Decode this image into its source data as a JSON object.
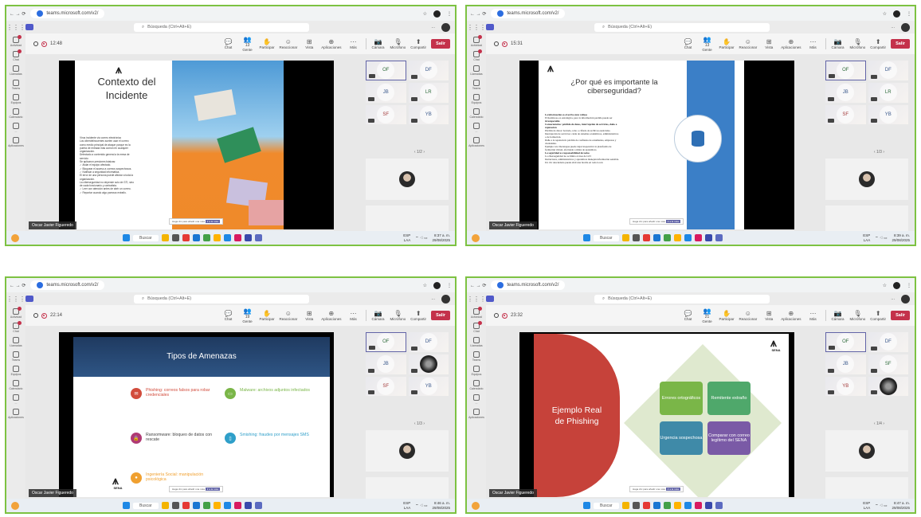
{
  "colors": {
    "frame": "#7dc242",
    "leave": "#c4314b",
    "teams": "#5059c9"
  },
  "browser": {
    "url": "teams.microsoft.com/v2/"
  },
  "app": {
    "search_placeholder": "Búsqueda (Ctrl+Alt+E)",
    "more": "..."
  },
  "rail": [
    "Actividad",
    "Chat",
    "Llamadas",
    "Teams",
    "Equipos",
    "Calendario",
    "...",
    "Aplicaciones"
  ],
  "toolbar": {
    "chat": "Chat",
    "people": "Gente",
    "raise": "Participar",
    "react": "Reaccionar",
    "view": "Vista",
    "apps": "Aplicaciones",
    "more": "Más",
    "camera": "Cámara",
    "mic": "Micrófono",
    "share": "Compartir",
    "leave": "Salir"
  },
  "taskbar": {
    "search": "Buscar",
    "lang": "ESP",
    "lang2": "LAA"
  },
  "slide_ui": {
    "chip_text": "Haga clic para añadir una nota",
    "chip_btn": "Ir a la nota"
  },
  "panels": [
    {
      "timer": "12:48",
      "people_count": "13",
      "tiles": [
        "OF",
        "DF",
        "JB",
        "LR",
        "SF",
        "YB"
      ],
      "pager": "1/2",
      "speaker": "Oscar Javier Figueredo",
      "clock_time": "8:37 a. m.",
      "clock_date": "29/08/2025",
      "slide": {
        "logo": "SENA",
        "title": "Contexto del Incidente",
        "body": [
          "Virus incidente vía correo electrónico",
          "Los ciberdelincuentes suelen usar el correo",
          "como medio principal de ataque porque es la",
          "puerta de entrada más común en cualquier",
          "organización.",
          "Detectado a contenido general a la mesa de",
          "servicio",
          "Se aplicaron presiones básicas:",
          "✓ Aislar el equipo afectado.",
          "✓ Bloquear el acceso a correos sospechosos.",
          "✓ Notificar a seguridad informática.",
          "El error de una persona puede afectar a toda la",
          "organización.",
          "La ciberseguridad no depende solo de GTI, sino",
          "de cada funcionario y contratista.",
          "✓ Leer con atención antes de abrir un correo.",
          "✓ Reportar cuando algo parezca extraño."
        ]
      }
    },
    {
      "timer": "15:31",
      "people_count": "13",
      "tiles": [
        "OF",
        "DF",
        "JB",
        "LR",
        "SF",
        "YB"
      ],
      "pager": "1/3",
      "speaker": "Oscar Javier Figueredo",
      "clock_time": "8:39 a. m.",
      "clock_date": "29/08/2025",
      "slide": {
        "title": "¿Por qué es importante la ciberseguridad?",
        "body": [
          {
            "b": true,
            "t": "La información es el activo más valioso"
          },
          {
            "b": false,
            "t": "El hackbroso es estratégica, pero la información perdida puede ser"
          },
          {
            "b": true,
            "t": "irrecuperable"
          },
          {
            "b": true,
            "t": "Consecuencias: pérdida de datos, interrupción de servicios, daño a"
          },
          {
            "b": true,
            "t": "reputación"
          },
          {
            "b": false,
            "t": "Pérdida de datos: borrado, robo o cifrado de archivos esenciales."
          },
          {
            "b": false,
            "t": "Interrupción de servicios: caída de sistemas académicos, administrativos"
          },
          {
            "b": false,
            "t": "o de formación."
          },
          {
            "b": false,
            "t": "Daño a la reputación: pérdida de confianza de estudiantes, empresas y"
          },
          {
            "b": false,
            "t": "ciudadanía."
          },
          {
            "b": false,
            "t": "Ejemplo: un ciberataque puede dejar inoperativa la plataforma de"
          },
          {
            "b": false,
            "t": "formación virtual, afectando a miles de aprendices."
          },
          {
            "b": true,
            "t": "La seguridad es responsabilidad de todos"
          },
          {
            "b": false,
            "t": "La ciberseguridad no se limita al área de GTI"
          },
          {
            "b": false,
            "t": "Instructores, administrativos y aprendices manejan información sensible."
          },
          {
            "b": false,
            "t": "Un clic descuidado puede abrir una brecha en toda la red."
          }
        ]
      }
    },
    {
      "timer": "22:14",
      "people_count": "19",
      "tiles": [
        "OF",
        "DF",
        "JB",
        "",
        "SF",
        "YB"
      ],
      "pager": "1/3",
      "speaker": "Oscar Javier Figueredo",
      "clock_time": "8:46 a. m.",
      "clock_date": "29/08/2025",
      "slide": {
        "title": "Tipos de Amenazas",
        "items": [
          {
            "text": "Phishing: correos falsos para robar credenciales",
            "color": "#d24c3c",
            "textcolor": "#d24c3c",
            "glyph": "✉"
          },
          {
            "text": "Malware: archivos adjuntos infectados",
            "color": "#7ab648",
            "textcolor": "#7ab648",
            "glyph": "▭"
          },
          {
            "text": "Ransomware: bloqueo de datos con rescate",
            "color": "#b03a74",
            "textcolor": "#444444",
            "glyph": "🔒"
          },
          {
            "text": "Smishing: fraudes por mensajes SMS",
            "color": "#2f9fc9",
            "textcolor": "#2f9fc9",
            "glyph": "▯"
          },
          {
            "text": "Ingeniería Social: manipulación psicológica",
            "color": "#f0a030",
            "textcolor": "#f0a030",
            "glyph": "●"
          }
        ],
        "logo": "SENA"
      }
    },
    {
      "timer": "23:32",
      "people_count": "21",
      "tiles": [
        "OF",
        "DF",
        "JB",
        "SF",
        "YB",
        ""
      ],
      "pager": "1/4",
      "speaker": "Oscar Javier Figueredo",
      "clock_time": "8:47 a. m.",
      "clock_date": "29/08/2025",
      "slide": {
        "title": "Ejemplo Real de Phishing",
        "logo": "SENA",
        "boxes": [
          {
            "text": "Errores ortográficos",
            "color": "#7ab648"
          },
          {
            "text": "Remitente extraño",
            "color": "#4fa86b"
          },
          {
            "text": "Urgencia sospechosa",
            "color": "#3f8aa8"
          },
          {
            "text": "Comparar con correo legítimo del SENA",
            "color": "#7a5aa6"
          }
        ]
      }
    }
  ]
}
